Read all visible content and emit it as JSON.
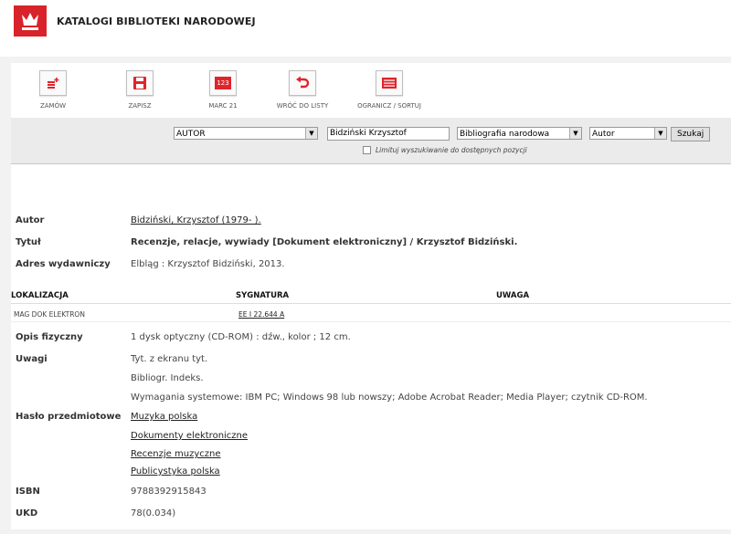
{
  "header": {
    "title": "KATALOGI BIBLIOTEKI NARODOWEJ"
  },
  "toolbar": {
    "order": "ZAMÓW",
    "save": "ZAPISZ",
    "marc": "MARC 21",
    "marc_icon_text": "123",
    "back": "WRÓĆ DO LISTY",
    "limit_sort": "OGRANICZ / SORTUJ"
  },
  "search": {
    "field": "AUTOR",
    "query": "Bidziński Krzysztof",
    "catalog": "Bibliografia narodowa",
    "sort": "Autor",
    "button": "Szukaj",
    "limit_label": "Limituj wyszukiwanie do dostępnych pozycji"
  },
  "record": {
    "author_label": "Autor",
    "author": "Bidziński, Krzysztof (1979- ).",
    "title_label": "Tytuł",
    "title": "Recenzje, relacje, wywiady [Dokument elektroniczny] / Krzysztof Bidziński.",
    "publisher_label": "Adres wydawniczy",
    "publisher": "Elbląg : Krzysztof Bidziński, 2013.",
    "loc_header": "LOKALIZACJA",
    "sig_header": "SYGNATURA",
    "note_header": "UWAGA",
    "location": "MAG DOK ELEKTRON",
    "signature": "EE I 22.644 A",
    "physical_label": "Opis fizyczny",
    "physical": "1 dysk optyczny (CD-ROM) : dźw., kolor ; 12 cm.",
    "notes_label": "Uwagi",
    "notes": [
      "Tyt. z ekranu tyt.",
      "Bibliogr. Indeks.",
      "Wymagania systemowe: IBM PC; Windows 98 lub nowszy; Adobe Acrobat Reader; Media Player; czytnik CD-ROM."
    ],
    "subject_label": "Hasło przedmiotowe",
    "subjects": [
      "Muzyka polska",
      "Dokumenty elektroniczne",
      "Recenzje muzyczne",
      "Publicystyka polska"
    ],
    "isbn_label": "ISBN",
    "isbn": "9788392915843",
    "ukd_label": "UKD",
    "ukd": "78(0.034)"
  },
  "colors": {
    "brand_red": "#d8232a",
    "icon_red": "#e0242b"
  }
}
